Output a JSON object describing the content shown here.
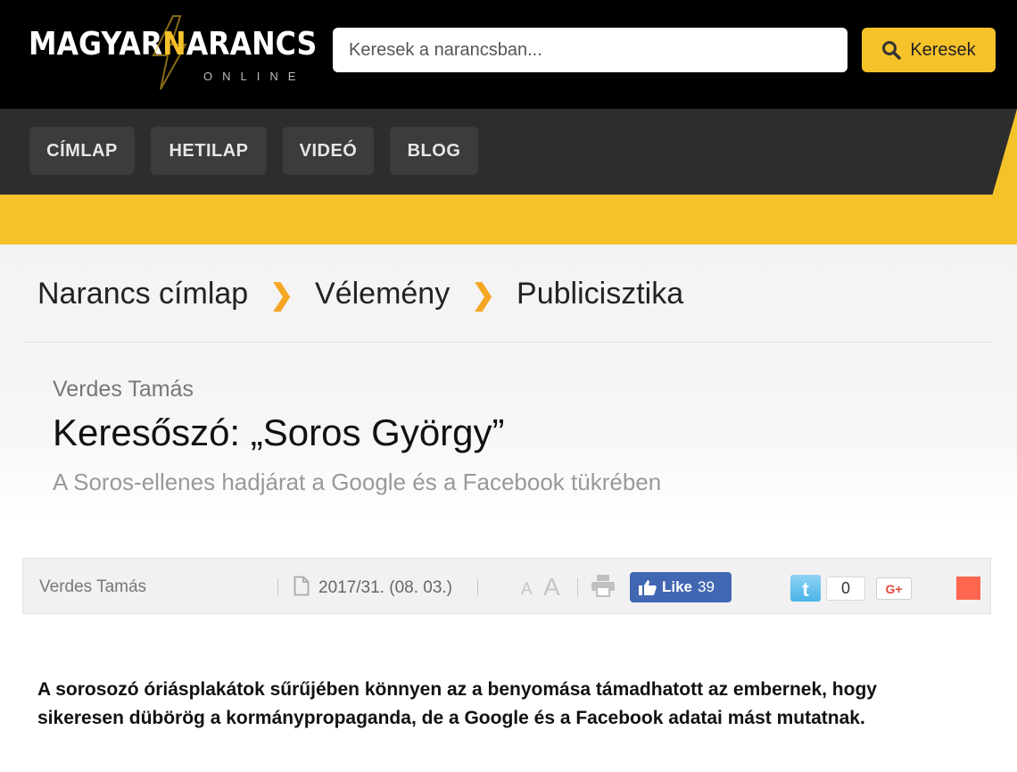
{
  "header": {
    "logo": {
      "word1": "MAGYAR",
      "bolt_letter": "N",
      "word2": "ARANCS",
      "subtitle": "ONLINE"
    },
    "search": {
      "placeholder": "Keresek a narancsban...",
      "button_label": "Keresek"
    }
  },
  "nav": {
    "items": [
      "CÍMLAP",
      "HETILAP",
      "VIDEÓ",
      "BLOG"
    ]
  },
  "breadcrumb": {
    "items": [
      "Narancs címlap",
      "Vélemény",
      "Publicisztika"
    ],
    "separator": "❯"
  },
  "article": {
    "author": "Verdes Tamás",
    "title": "Keresőszó: „Soros György”",
    "subtitle": "A Soros-ellenes hadjárat a Google és a Facebook tükrében",
    "lead": "A sorosozó óriásplakátok sűrűjében könnyen az a benyomása támadhatott az embernek, hogy sikeresen dübörög a kormánypropaganda, de a Google és a Facebook adatai mást mutatnak."
  },
  "meta": {
    "author": "Verdes Tamás",
    "issue": "2017/31. (08. 03.)",
    "font_small": "A",
    "font_large": "A",
    "like_label": "Like",
    "like_count": "39",
    "twitter_count": "0",
    "gplus_label": "G+"
  },
  "colors": {
    "accent": "#f5c22a",
    "header_bg": "#000000",
    "nav_bg": "#2d2d2d",
    "facebook": "#4267b2",
    "red_square": "#ff6650",
    "breadcrumb_sep": "#f5a623"
  },
  "icons": [
    "bolt-icon",
    "search-icon",
    "document-icon",
    "print-icon",
    "thumbs-up-icon",
    "twitter-icon",
    "google-plus-icon"
  ]
}
